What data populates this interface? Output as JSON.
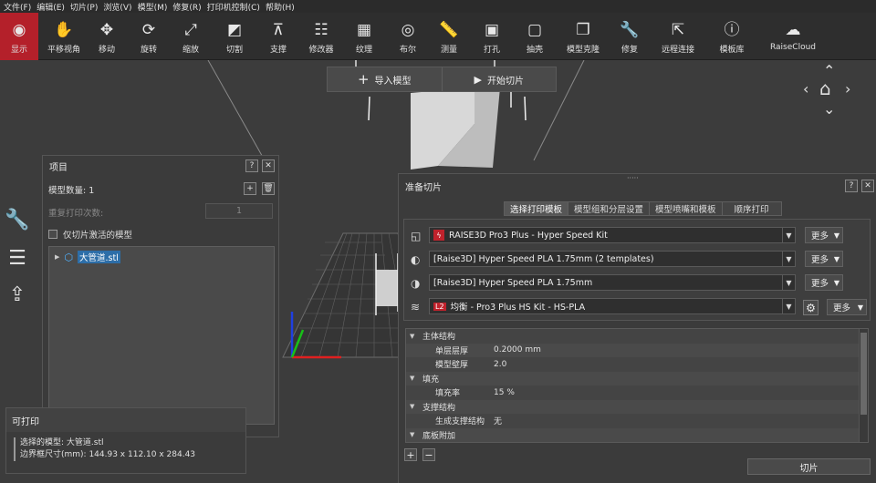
{
  "menu": [
    "文件(F)",
    "编辑(E)",
    "切片(P)",
    "浏览(V)",
    "模型(M)",
    "修复(R)",
    "打印机控制(C)",
    "帮助(H)"
  ],
  "toolbar": [
    {
      "label": "显示",
      "icon": "eye-icon",
      "glyph": "◉"
    },
    {
      "label": "平移视角",
      "icon": "hand-icon",
      "glyph": "✋"
    },
    {
      "label": "移动",
      "icon": "move-icon",
      "glyph": "✥"
    },
    {
      "label": "旋转",
      "icon": "rotate-icon",
      "glyph": "⟳"
    },
    {
      "label": "缩放",
      "icon": "scale-icon",
      "glyph": "⤢"
    },
    {
      "label": "切割",
      "icon": "cut-icon",
      "glyph": "◩"
    },
    {
      "label": "支撑",
      "icon": "support-icon",
      "glyph": "⊼"
    },
    {
      "label": "修改器",
      "icon": "modifier-icon",
      "glyph": "☷"
    },
    {
      "label": "纹理",
      "icon": "texture-icon",
      "glyph": "▦"
    },
    {
      "label": "布尔",
      "icon": "boolean-icon",
      "glyph": "◎"
    },
    {
      "label": "测量",
      "icon": "ruler-icon",
      "glyph": "📏"
    },
    {
      "label": "打孔",
      "icon": "hole-icon",
      "glyph": "▣"
    },
    {
      "label": "抽壳",
      "icon": "shell-icon",
      "glyph": "▢"
    },
    {
      "label": "模型克隆",
      "icon": "clone-icon",
      "glyph": "❐"
    },
    {
      "label": "修复",
      "icon": "wrench-icon",
      "glyph": "🔧"
    },
    {
      "label": "远程连接",
      "icon": "remote-icon",
      "glyph": "⇱"
    },
    {
      "label": "模板库",
      "icon": "library-icon",
      "glyph": "ⓘ"
    },
    {
      "label": "RaiseCloud",
      "icon": "cloud-icon",
      "glyph": "☁"
    }
  ],
  "quickbar": {
    "import": "导入模型",
    "slice": "开始切片"
  },
  "project": {
    "title": "项目",
    "model_count": "模型数量: 1",
    "repeat_label": "重复打印次数:",
    "repeat_value": "1",
    "only_active_label": "仅切片激活的模型",
    "tree_item": "大管道.stl"
  },
  "info": {
    "title": "可打印",
    "selected": "选择的模型: 大管道.stl",
    "bbox": "边界框尺寸(mm): 144.93 x 112.10 x 284.43"
  },
  "prepare": {
    "title": "准备切片",
    "tabs": [
      "选择打印模板",
      "模型组和分层设置",
      "模型喷嘴和模板",
      "顺序打印"
    ],
    "printer": "RAISE3D Pro3 Plus - Hyper Speed Kit",
    "material_left": "[Raise3D] Hyper Speed PLA 1.75mm (2 templates)",
    "material_right": "[Raise3D] Hyper Speed PLA 1.75mm",
    "profile_tag": "L2",
    "profile": "均衡 - Pro3 Plus HS Kit - HS-PLA",
    "more": "更多",
    "settings": [
      {
        "type": "section",
        "label": "主体结构"
      },
      {
        "type": "item",
        "key": "单层层厚",
        "value": "0.2000 mm"
      },
      {
        "type": "item",
        "key": "模型壁厚",
        "value": "2.0"
      },
      {
        "type": "section",
        "label": "填充"
      },
      {
        "type": "item",
        "key": "填充率",
        "value": "15 %"
      },
      {
        "type": "section",
        "label": "支撑结构"
      },
      {
        "type": "item",
        "key": "生成支撑结构",
        "value": "无"
      },
      {
        "type": "section",
        "label": "底板附加"
      }
    ],
    "slice_button": "切片"
  },
  "colors": {
    "accent": "#b4202a",
    "background": "#3c3c3c",
    "panel": "#3b3b3b"
  }
}
